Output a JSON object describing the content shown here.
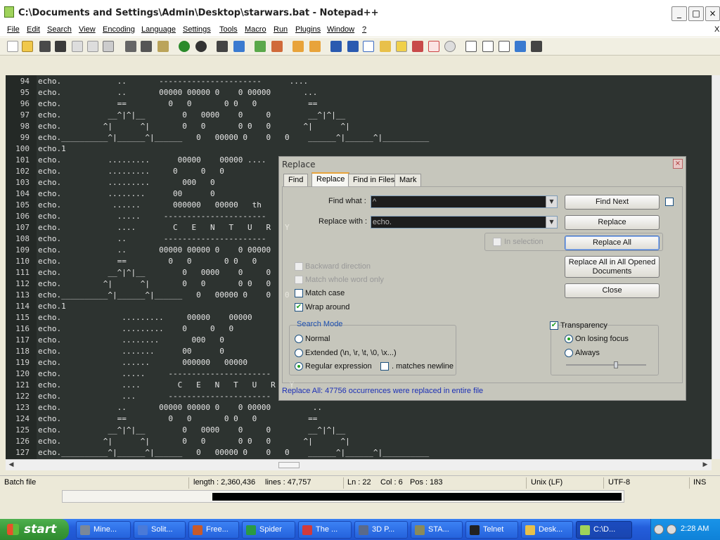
{
  "window": {
    "title": "C:\\Documents and Settings\\Admin\\Desktop\\starwars.bat - Notepad++",
    "minimize": "_",
    "maximize": "□",
    "close": "×"
  },
  "menu": [
    "File",
    "Edit",
    "Search",
    "View",
    "Encoding",
    "Language",
    "Settings",
    "Tools",
    "Macro",
    "Run",
    "Plugins",
    "Window",
    "?"
  ],
  "menu_close": "X",
  "editor": {
    "lines": [
      {
        "n": "94",
        "t": "echo.            ..       ----------------------      ...."
      },
      {
        "n": "95",
        "t": "echo.            ..       00000 00000 0    0 00000       ..."
      },
      {
        "n": "96",
        "t": "echo.            ==         0   0       0 0   0           =="
      },
      {
        "n": "97",
        "t": "echo.          __^|^|__        0   0000    0     0        __^|^|__"
      },
      {
        "n": "98",
        "t": "echo.         ^|      ^|       0   0       0 0   0       ^|      ^|"
      },
      {
        "n": "99",
        "t": "echo.__________^|______^|______   0   00000 0    0   0    ______^|______^|__________"
      },
      {
        "n": "100",
        "t": "echo.1"
      },
      {
        "n": "101",
        "t": "echo.          .........      00000    00000 ...."
      },
      {
        "n": "102",
        "t": "echo.          .........     0     0   0"
      },
      {
        "n": "103",
        "t": "echo.          .........       000   0"
      },
      {
        "n": "104",
        "t": "echo.          ........      00      0"
      },
      {
        "n": "105",
        "t": "echo.           ......       000000   00000   th"
      },
      {
        "n": "106",
        "t": "echo.            .....     ----------------------"
      },
      {
        "n": "107",
        "t": "echo.            ....        C   E   N   T   U   R   Y"
      },
      {
        "n": "108",
        "t": "echo.            ..        ----------------------"
      },
      {
        "n": "109",
        "t": "echo.            ..       00000 00000 0    0 00000"
      },
      {
        "n": "110",
        "t": "echo.            ==         0   0       0 0   0"
      },
      {
        "n": "111",
        "t": "echo.          __^|^|__        0   0000    0     0"
      },
      {
        "n": "112",
        "t": "echo.         ^|      ^|       0   0       0 0   0"
      },
      {
        "n": "113",
        "t": "echo.__________^|______^|______   0   00000 0    0   0"
      },
      {
        "n": "114",
        "t": "echo.1"
      },
      {
        "n": "115",
        "t": "echo.             .........     00000    00000"
      },
      {
        "n": "116",
        "t": "echo.             .........    0     0   0"
      },
      {
        "n": "117",
        "t": "echo.             ........       000   0"
      },
      {
        "n": "118",
        "t": "echo.             .......      00      0"
      },
      {
        "n": "119",
        "t": "echo.             ......       000000   00000"
      },
      {
        "n": "120",
        "t": "echo.             .....     ----------------------"
      },
      {
        "n": "121",
        "t": "echo.             ....        C   E   N   T   U   R   Y"
      },
      {
        "n": "122",
        "t": "echo.             ...       ----------------------"
      },
      {
        "n": "123",
        "t": "echo.            ..       00000 00000 0    0 00000         .."
      },
      {
        "n": "124",
        "t": "echo.            ==         0   0       0 0   0           =="
      },
      {
        "n": "125",
        "t": "echo.          __^|^|__        0   0000    0     0        __^|^|__"
      },
      {
        "n": "126",
        "t": "echo.         ^|      ^|       0   0       0 0   0       ^|      ^|"
      },
      {
        "n": "127",
        "t": "echo.__________^|______^|______   0   00000 0    0   0    ______^|______^|__________"
      }
    ]
  },
  "status": {
    "file_type": "Batch file",
    "length": "length : 2,360,436",
    "lines": "lines : 47,757",
    "ln": "Ln : 22",
    "col": "Col : 6",
    "pos": "Pos : 183",
    "eol": "Unix (LF)",
    "encoding": "UTF-8",
    "mode": "INS"
  },
  "dialog": {
    "title": "Replace",
    "close": "×",
    "tabs": [
      "Find",
      "Replace",
      "Find in Files",
      "Mark"
    ],
    "find_what_label": "Find what :",
    "find_what_value": "^",
    "replace_with_label": "Replace with :",
    "replace_with_value": "echo.",
    "in_selection": "In selection",
    "backward_direction": "Backward direction",
    "match_whole_word": "Match whole word only",
    "match_case": "Match case",
    "wrap_around": "Wrap around",
    "search_mode_title": "Search Mode",
    "mode_normal": "Normal",
    "mode_extended": "Extended (\\n, \\r, \\t, \\0, \\x...)",
    "mode_regex": "Regular expression",
    "matches_newline": ". matches newline",
    "transparency_title": "Transparency",
    "on_losing_focus": "On losing focus",
    "always": "Always",
    "transparency_level": 0.62,
    "buttons": {
      "find_next": "Find Next",
      "replace": "Replace",
      "replace_all": "Replace All",
      "replace_all_opened_1": "Replace All in All Opened",
      "replace_all_opened_2": "Documents",
      "close": "Close"
    },
    "status": "Replace All: 47756 occurrences were replaced in entire file"
  },
  "taskbar": {
    "start": "start",
    "tasks": [
      {
        "label": "Mine...",
        "icon_color": "#7a8899"
      },
      {
        "label": "Solit...",
        "icon_color": "#4a7ad8"
      },
      {
        "label": "Free...",
        "icon_color": "#c85a2a"
      },
      {
        "label": "Spider",
        "icon_color": "#2a9a44"
      },
      {
        "label": "The ...",
        "icon_color": "#d23a3a"
      },
      {
        "label": "3D P...",
        "icon_color": "#5a6a8a"
      },
      {
        "label": "STA...",
        "icon_color": "#8a8a5a"
      },
      {
        "label": "Telnet",
        "icon_color": "#222222"
      },
      {
        "label": "Desk...",
        "icon_color": "#e8c04a"
      },
      {
        "label": "C:\\D...",
        "icon_color": "#9fd35b"
      }
    ],
    "clock": "2:28 AM"
  }
}
